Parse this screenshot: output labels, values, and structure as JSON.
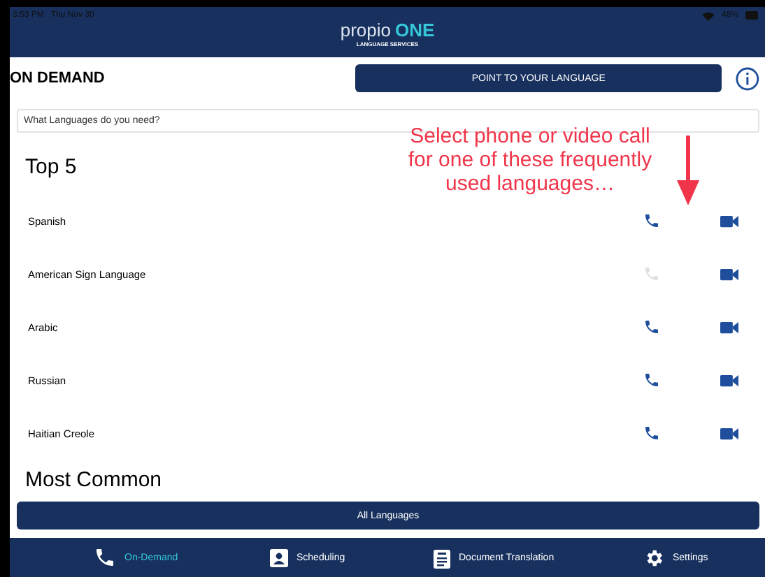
{
  "status_bar": {
    "time": "3:53 PM",
    "date": "Thu Nov 30",
    "battery": "48%"
  },
  "logo": {
    "name": "propio",
    "brand": "ONE",
    "subtitle": "LANGUAGE SERVICES"
  },
  "title": "ON DEMAND",
  "point_button": "POINT TO YOUR LANGUAGE",
  "search": {
    "placeholder": "What Languages do you need?"
  },
  "annotation": "Select phone or video call for one of these frequently used languages…",
  "top_heading": "Top 5",
  "languages": [
    {
      "name": "Spanish",
      "phone_enabled": true
    },
    {
      "name": "American Sign Language",
      "phone_enabled": false
    },
    {
      "name": "Arabic",
      "phone_enabled": true
    },
    {
      "name": "Russian",
      "phone_enabled": true
    },
    {
      "name": "Haitian Creole",
      "phone_enabled": true
    }
  ],
  "common_heading": "Most Common",
  "all_button": "All Languages",
  "tabs": [
    {
      "label": "On-Demand",
      "kind": "phone",
      "selected": true
    },
    {
      "label": "Scheduling",
      "kind": "contact",
      "selected": false
    },
    {
      "label": "Document Translation",
      "kind": "clipboard",
      "selected": false
    },
    {
      "label": "Settings",
      "kind": "gear",
      "selected": false
    }
  ]
}
